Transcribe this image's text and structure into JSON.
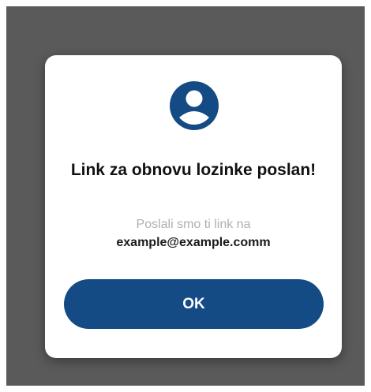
{
  "dialog": {
    "icon": "user-avatar-icon",
    "title": "Link za obnovu lozinke poslan!",
    "message_prefix": "Poslali smo ti link na",
    "email": "example@example.comm",
    "ok_label": "OK"
  },
  "colors": {
    "overlay": "#5a5a5a",
    "primary": "#144b84",
    "muted_text": "#b0b0b0"
  }
}
